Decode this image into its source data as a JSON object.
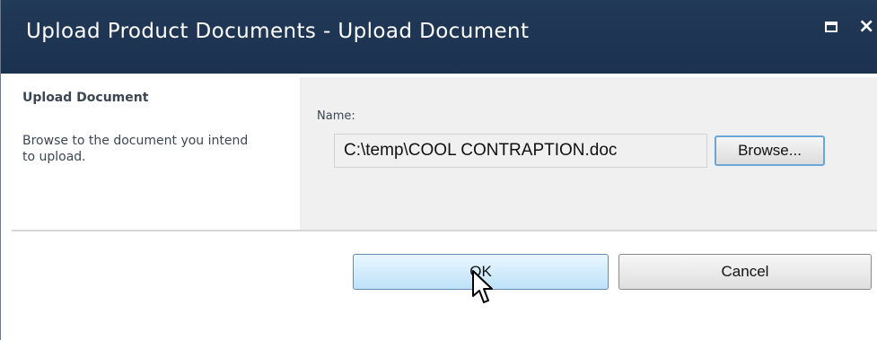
{
  "dialog": {
    "title": "Upload Product Documents - Upload Document",
    "maximize_icon": "maximize-icon",
    "close_icon": "close-icon",
    "close_glyph": "×"
  },
  "section": {
    "title": "Upload Document",
    "description": "Browse to the document you intend to upload."
  },
  "form": {
    "name_label": "Name:",
    "file_value": "C:\\temp\\COOL CONTRAPTION.doc",
    "browse_label": "Browse..."
  },
  "actions": {
    "ok_label": "OK",
    "cancel_label": "Cancel"
  },
  "colors": {
    "titlebar": "#1d3352",
    "panel_gray": "#f0f0f0",
    "ok_blue": "#bde2f8",
    "focus_border": "#6aa6d8"
  }
}
